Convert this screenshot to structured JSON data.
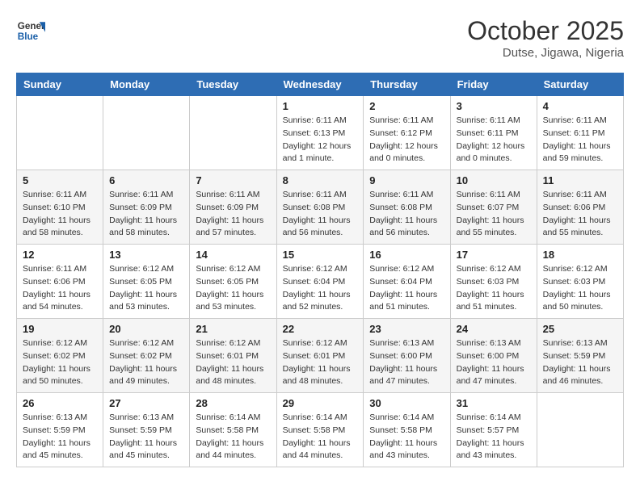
{
  "header": {
    "logo_line1": "General",
    "logo_line2": "Blue",
    "month": "October 2025",
    "location": "Dutse, Jigawa, Nigeria"
  },
  "weekdays": [
    "Sunday",
    "Monday",
    "Tuesday",
    "Wednesday",
    "Thursday",
    "Friday",
    "Saturday"
  ],
  "weeks": [
    [
      {
        "day": "",
        "sunrise": "",
        "sunset": "",
        "daylight": ""
      },
      {
        "day": "",
        "sunrise": "",
        "sunset": "",
        "daylight": ""
      },
      {
        "day": "",
        "sunrise": "",
        "sunset": "",
        "daylight": ""
      },
      {
        "day": "1",
        "sunrise": "Sunrise: 6:11 AM",
        "sunset": "Sunset: 6:13 PM",
        "daylight": "Daylight: 12 hours and 1 minute."
      },
      {
        "day": "2",
        "sunrise": "Sunrise: 6:11 AM",
        "sunset": "Sunset: 6:12 PM",
        "daylight": "Daylight: 12 hours and 0 minutes."
      },
      {
        "day": "3",
        "sunrise": "Sunrise: 6:11 AM",
        "sunset": "Sunset: 6:11 PM",
        "daylight": "Daylight: 12 hours and 0 minutes."
      },
      {
        "day": "4",
        "sunrise": "Sunrise: 6:11 AM",
        "sunset": "Sunset: 6:11 PM",
        "daylight": "Daylight: 11 hours and 59 minutes."
      }
    ],
    [
      {
        "day": "5",
        "sunrise": "Sunrise: 6:11 AM",
        "sunset": "Sunset: 6:10 PM",
        "daylight": "Daylight: 11 hours and 58 minutes."
      },
      {
        "day": "6",
        "sunrise": "Sunrise: 6:11 AM",
        "sunset": "Sunset: 6:09 PM",
        "daylight": "Daylight: 11 hours and 58 minutes."
      },
      {
        "day": "7",
        "sunrise": "Sunrise: 6:11 AM",
        "sunset": "Sunset: 6:09 PM",
        "daylight": "Daylight: 11 hours and 57 minutes."
      },
      {
        "day": "8",
        "sunrise": "Sunrise: 6:11 AM",
        "sunset": "Sunset: 6:08 PM",
        "daylight": "Daylight: 11 hours and 56 minutes."
      },
      {
        "day": "9",
        "sunrise": "Sunrise: 6:11 AM",
        "sunset": "Sunset: 6:08 PM",
        "daylight": "Daylight: 11 hours and 56 minutes."
      },
      {
        "day": "10",
        "sunrise": "Sunrise: 6:11 AM",
        "sunset": "Sunset: 6:07 PM",
        "daylight": "Daylight: 11 hours and 55 minutes."
      },
      {
        "day": "11",
        "sunrise": "Sunrise: 6:11 AM",
        "sunset": "Sunset: 6:06 PM",
        "daylight": "Daylight: 11 hours and 55 minutes."
      }
    ],
    [
      {
        "day": "12",
        "sunrise": "Sunrise: 6:11 AM",
        "sunset": "Sunset: 6:06 PM",
        "daylight": "Daylight: 11 hours and 54 minutes."
      },
      {
        "day": "13",
        "sunrise": "Sunrise: 6:12 AM",
        "sunset": "Sunset: 6:05 PM",
        "daylight": "Daylight: 11 hours and 53 minutes."
      },
      {
        "day": "14",
        "sunrise": "Sunrise: 6:12 AM",
        "sunset": "Sunset: 6:05 PM",
        "daylight": "Daylight: 11 hours and 53 minutes."
      },
      {
        "day": "15",
        "sunrise": "Sunrise: 6:12 AM",
        "sunset": "Sunset: 6:04 PM",
        "daylight": "Daylight: 11 hours and 52 minutes."
      },
      {
        "day": "16",
        "sunrise": "Sunrise: 6:12 AM",
        "sunset": "Sunset: 6:04 PM",
        "daylight": "Daylight: 11 hours and 51 minutes."
      },
      {
        "day": "17",
        "sunrise": "Sunrise: 6:12 AM",
        "sunset": "Sunset: 6:03 PM",
        "daylight": "Daylight: 11 hours and 51 minutes."
      },
      {
        "day": "18",
        "sunrise": "Sunrise: 6:12 AM",
        "sunset": "Sunset: 6:03 PM",
        "daylight": "Daylight: 11 hours and 50 minutes."
      }
    ],
    [
      {
        "day": "19",
        "sunrise": "Sunrise: 6:12 AM",
        "sunset": "Sunset: 6:02 PM",
        "daylight": "Daylight: 11 hours and 50 minutes."
      },
      {
        "day": "20",
        "sunrise": "Sunrise: 6:12 AM",
        "sunset": "Sunset: 6:02 PM",
        "daylight": "Daylight: 11 hours and 49 minutes."
      },
      {
        "day": "21",
        "sunrise": "Sunrise: 6:12 AM",
        "sunset": "Sunset: 6:01 PM",
        "daylight": "Daylight: 11 hours and 48 minutes."
      },
      {
        "day": "22",
        "sunrise": "Sunrise: 6:12 AM",
        "sunset": "Sunset: 6:01 PM",
        "daylight": "Daylight: 11 hours and 48 minutes."
      },
      {
        "day": "23",
        "sunrise": "Sunrise: 6:13 AM",
        "sunset": "Sunset: 6:00 PM",
        "daylight": "Daylight: 11 hours and 47 minutes."
      },
      {
        "day": "24",
        "sunrise": "Sunrise: 6:13 AM",
        "sunset": "Sunset: 6:00 PM",
        "daylight": "Daylight: 11 hours and 47 minutes."
      },
      {
        "day": "25",
        "sunrise": "Sunrise: 6:13 AM",
        "sunset": "Sunset: 5:59 PM",
        "daylight": "Daylight: 11 hours and 46 minutes."
      }
    ],
    [
      {
        "day": "26",
        "sunrise": "Sunrise: 6:13 AM",
        "sunset": "Sunset: 5:59 PM",
        "daylight": "Daylight: 11 hours and 45 minutes."
      },
      {
        "day": "27",
        "sunrise": "Sunrise: 6:13 AM",
        "sunset": "Sunset: 5:59 PM",
        "daylight": "Daylight: 11 hours and 45 minutes."
      },
      {
        "day": "28",
        "sunrise": "Sunrise: 6:14 AM",
        "sunset": "Sunset: 5:58 PM",
        "daylight": "Daylight: 11 hours and 44 minutes."
      },
      {
        "day": "29",
        "sunrise": "Sunrise: 6:14 AM",
        "sunset": "Sunset: 5:58 PM",
        "daylight": "Daylight: 11 hours and 44 minutes."
      },
      {
        "day": "30",
        "sunrise": "Sunrise: 6:14 AM",
        "sunset": "Sunset: 5:58 PM",
        "daylight": "Daylight: 11 hours and 43 minutes."
      },
      {
        "day": "31",
        "sunrise": "Sunrise: 6:14 AM",
        "sunset": "Sunset: 5:57 PM",
        "daylight": "Daylight: 11 hours and 43 minutes."
      },
      {
        "day": "",
        "sunrise": "",
        "sunset": "",
        "daylight": ""
      }
    ]
  ]
}
